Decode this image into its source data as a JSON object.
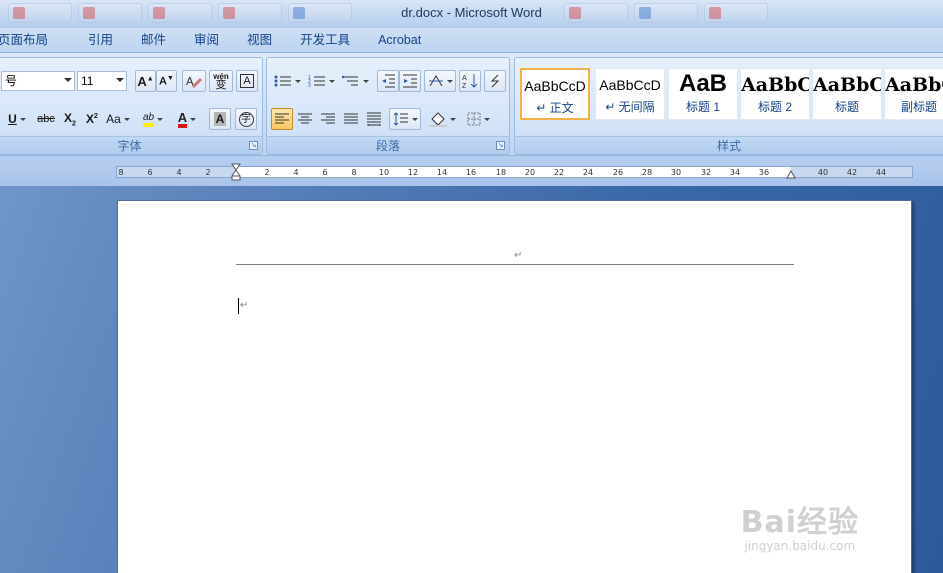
{
  "window": {
    "title": "dr.docx - Microsoft Word"
  },
  "tabs": [
    "页面布局",
    "引用",
    "邮件",
    "审阅",
    "视图",
    "开发工具",
    "Acrobat"
  ],
  "font_group": {
    "font_name_fragment": "号",
    "font_size": "11",
    "label": "字体",
    "buttons": {
      "grow": "A",
      "shrink": "A",
      "phonetic": "wén",
      "underline": "U",
      "strike": "abc",
      "subscript": "X",
      "superscript": "X",
      "case": "Aa",
      "highlight": "ab",
      "font_color": "A",
      "shading": "A",
      "enclose": "字"
    }
  },
  "paragraph_group": {
    "label": "段落"
  },
  "styles_group": {
    "label": "样式",
    "items": [
      {
        "sample": "AaBbCcD",
        "name": "↵ 正文"
      },
      {
        "sample": "AaBbCcD",
        "name": "↵ 无间隔"
      },
      {
        "sample": "AaB",
        "name": "标题 1"
      },
      {
        "sample": "AaBbC",
        "name": "标题 2"
      },
      {
        "sample": "AaBbC",
        "name": "标题"
      },
      {
        "sample": "AaBbC",
        "name": "副标题"
      }
    ]
  },
  "ruler": {
    "ticks": [
      "8",
      "6",
      "4",
      "2",
      "2",
      "4",
      "6",
      "8",
      "10",
      "12",
      "14",
      "16",
      "18",
      "20",
      "22",
      "24",
      "26",
      "28",
      "30",
      "32",
      "34",
      "36",
      "40",
      "42",
      "44"
    ]
  },
  "document": {
    "header_mark": "↵",
    "body_mark": "↵"
  },
  "watermark": {
    "main": "Bai经验",
    "sub": "jingyan.baidu.com"
  },
  "colors": {
    "accent": "#15428b",
    "highlight": "#f8c660",
    "font_red": "#e01010",
    "highlight_yellow": "#ffee00"
  }
}
